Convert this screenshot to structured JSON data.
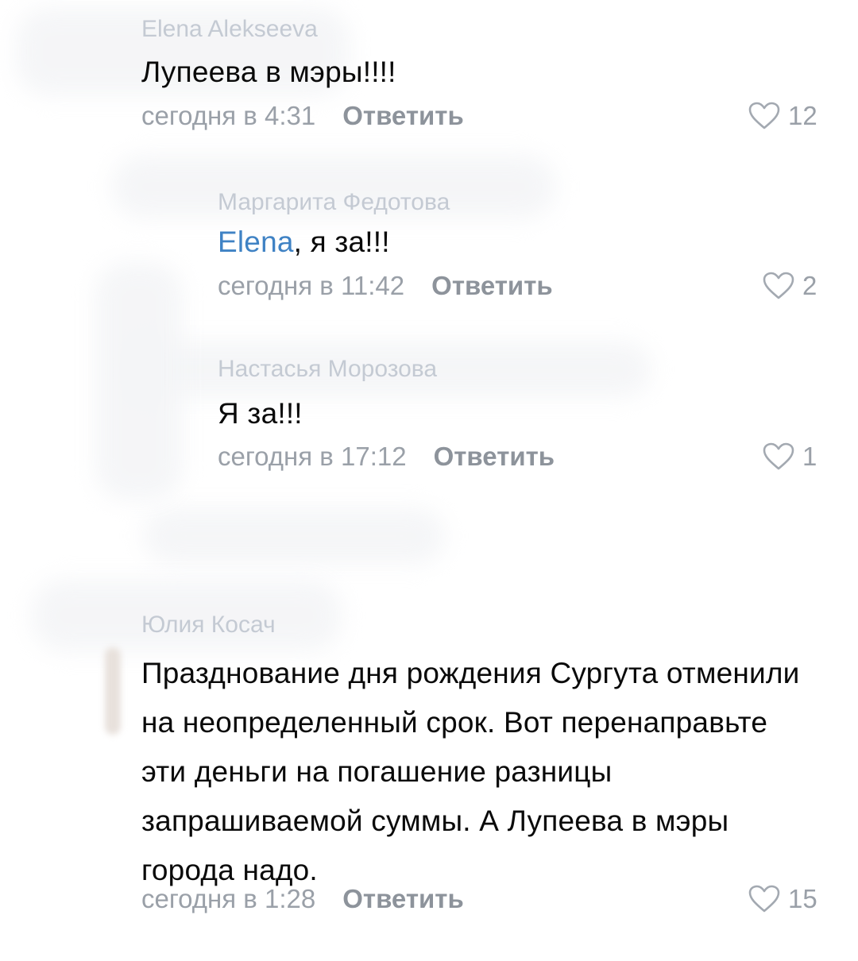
{
  "comments": [
    {
      "author": "Elena Alekseeva",
      "text": "Лупеева в мэры!!!!",
      "time": "сегодня в 4:31",
      "reply": "Ответить",
      "likes": "12"
    },
    {
      "author": "Маргарита Федотова",
      "mention": "Elena",
      "text": ", я за!!!",
      "time": "сегодня в 11:42",
      "reply": "Ответить",
      "likes": "2"
    },
    {
      "author": "Настасья Морозова",
      "text": "Я за!!!",
      "time": "сегодня в 17:12",
      "reply": "Ответить",
      "likes": "1"
    },
    {
      "author": "Юлия Косач",
      "text": "Празднование дня рождения Сургута отменили на неопределенный срок. Вот перенаправьте эти деньги на погашение разницы запрашиваемой суммы. А Лупеева в мэры города надо.",
      "time": "сегодня в 1:28",
      "reply": "Ответить",
      "likes": "15"
    }
  ],
  "colors": {
    "meta": "#9aa0a8",
    "mention": "#3f82c4",
    "text": "#0a0a0a"
  }
}
